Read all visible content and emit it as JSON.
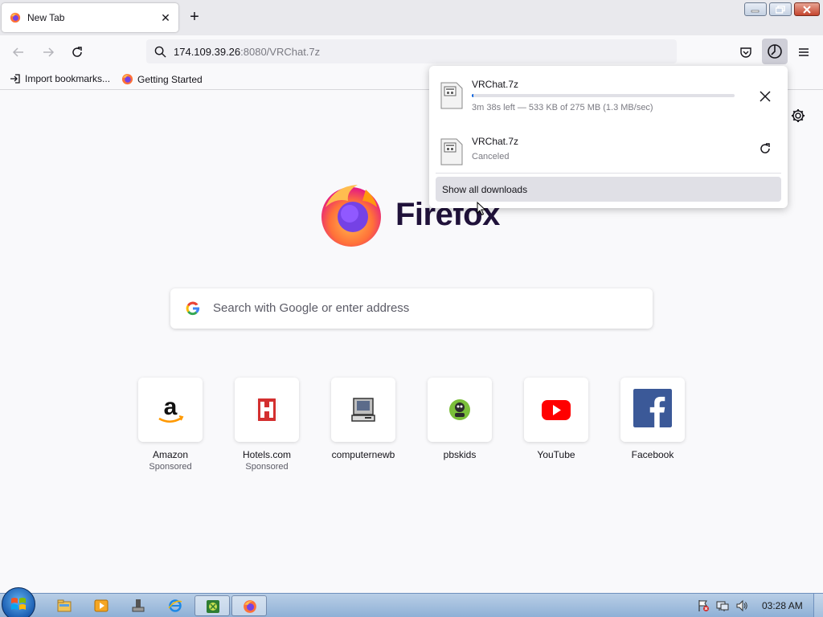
{
  "tab": {
    "title": "New Tab",
    "close_glyph": "✕",
    "new_tab_glyph": "+"
  },
  "nav": {
    "url_host": "174.109.39.26",
    "url_rest": ":8080/VRChat.7z"
  },
  "bookmarks": [
    {
      "label": "Import bookmarks...",
      "icon": "import-icon"
    },
    {
      "label": "Getting Started",
      "icon": "firefox-icon"
    }
  ],
  "newtab": {
    "wordmark": "Firefox",
    "search_placeholder": "Search with Google or enter address",
    "tiles": [
      {
        "name": "Amazon",
        "sponsor": "Sponsored",
        "icon": "amazon-icon"
      },
      {
        "name": "Hotels.com",
        "sponsor": "Sponsored",
        "icon": "hotels-icon"
      },
      {
        "name": "computernewb",
        "sponsor": "",
        "icon": "computer-icon"
      },
      {
        "name": "pbskids",
        "sponsor": "",
        "icon": "pbskids-icon"
      },
      {
        "name": "YouTube",
        "sponsor": "",
        "icon": "youtube-icon"
      },
      {
        "name": "Facebook",
        "sponsor": "",
        "icon": "facebook-icon"
      }
    ]
  },
  "downloads": {
    "items": [
      {
        "name": "VRChat.7z",
        "status": "3m 38s left — 533 KB of 275 MB (1.3 MB/sec)",
        "progress": 0.002,
        "action": "cancel-icon"
      },
      {
        "name": "VRChat.7z",
        "status": "Canceled",
        "action": "retry-icon"
      }
    ],
    "show_all": "Show all downloads"
  },
  "taskbar": {
    "clock": "03:28 AM",
    "apps": [
      "explorer-icon",
      "media-player-icon",
      "usb-icon",
      "ie-icon",
      "xbox-icon",
      "firefox-icon"
    ],
    "active_app": "firefox-icon"
  },
  "colors": {
    "accent": "#0060df",
    "wordmark": "#20123a",
    "youtube": "#ff0000",
    "facebook": "#3b5998",
    "hotels": "#d32f2f"
  }
}
